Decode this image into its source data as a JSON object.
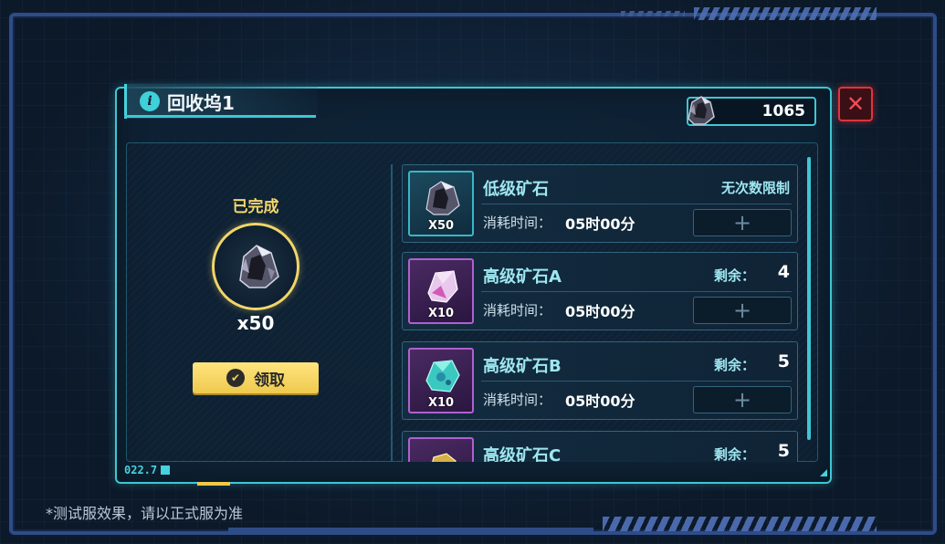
{
  "window": {
    "title": "回收坞1",
    "currency_value": "1065",
    "close_symbol": "✕"
  },
  "reward": {
    "status": "已完成",
    "quantity": "x50",
    "claim_label": "领取"
  },
  "items": [
    {
      "name": "低级矿石",
      "thumb_qty": "X50",
      "limit_text": "无次数限制",
      "time_label": "消耗时间：",
      "time_value": "05时00分",
      "add_symbol": "+",
      "frame_color": "#37b7c8"
    },
    {
      "name": "高级矿石A",
      "thumb_qty": "X10",
      "remain_label": "剩余：",
      "remain_value": "4",
      "time_label": "消耗时间：",
      "time_value": "05时00分",
      "add_symbol": "+",
      "frame_color": "#b060d0"
    },
    {
      "name": "高级矿石B",
      "thumb_qty": "X10",
      "remain_label": "剩余：",
      "remain_value": "5",
      "time_label": "消耗时间：",
      "time_value": "05时00分",
      "add_symbol": "+",
      "frame_color": "#b060d0"
    },
    {
      "name": "高级矿石C",
      "remain_label": "剩余：",
      "remain_value": "5",
      "frame_color": "#b060d0"
    }
  ],
  "footer": {
    "code": "022.7",
    "disclaimer": "*测试服效果，请以正式服为准"
  },
  "colors": {
    "accent": "#3fc6d3",
    "gold": "#f0d56a",
    "close_red": "#e0343a"
  }
}
